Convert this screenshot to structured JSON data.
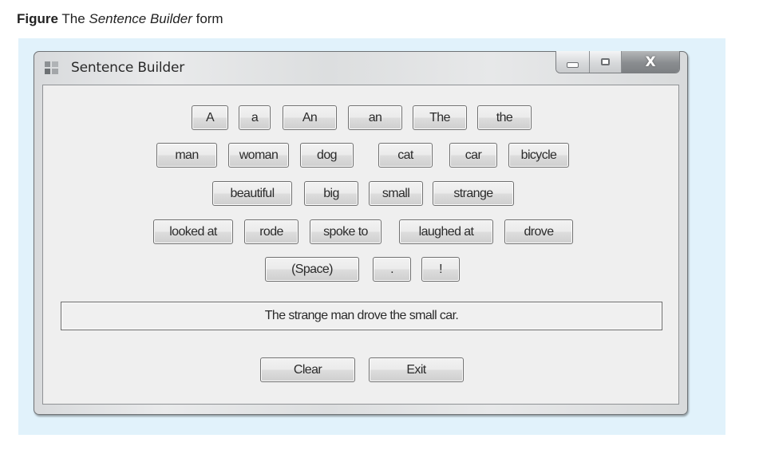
{
  "caption": {
    "label": "Figure",
    "prefix": " The ",
    "title_italic": "Sentence Builder",
    "suffix": " form"
  },
  "window": {
    "title": "Sentence Builder",
    "icon": "app-form-icon",
    "controls": {
      "minimize": "minimize-icon",
      "maximize": "maximize-icon",
      "close_glyph": "X"
    }
  },
  "word_rows": [
    [
      "A",
      "a",
      "An",
      "an",
      "The",
      "the"
    ],
    [
      "man",
      "woman",
      "dog",
      "cat",
      "car",
      "bicycle"
    ],
    [
      "beautiful",
      "big",
      "small",
      "strange"
    ],
    [
      "looked at",
      "rode",
      "spoke to",
      "laughed at",
      "drove"
    ],
    [
      "(Space)",
      ".",
      "!"
    ]
  ],
  "sentence_output": "The strange man drove the small car.",
  "actions": {
    "clear_label": "Clear",
    "exit_label": "Exit"
  }
}
